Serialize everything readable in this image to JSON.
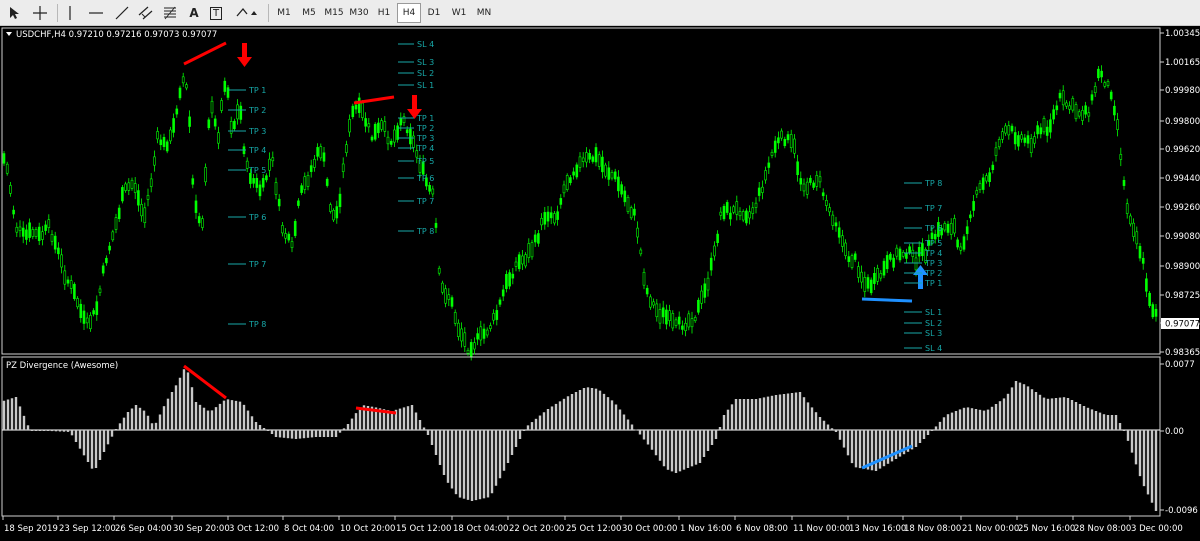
{
  "toolbar": {
    "drawing_tools": [
      "cursor-icon",
      "crosshair-icon",
      "vertical-line-icon",
      "horizontal-line-icon",
      "trendline-icon",
      "equidistant-channel-icon",
      "fibonacci-icon",
      "text-icon",
      "text-label-icon",
      "arrows-icon"
    ],
    "text_tool_label": "A",
    "text_label_tool_label": "T",
    "timeframes": [
      "M1",
      "M5",
      "M15",
      "M30",
      "H1",
      "H4",
      "D1",
      "W1",
      "MN"
    ],
    "selected_timeframe": "H4"
  },
  "chart": {
    "symbol_header": "USDCHF,H4  0.97210 0.97216 0.97073 0.97077",
    "price_ticks": [
      "1.00345",
      "1.00165",
      "0.99980",
      "0.99800",
      "0.99620",
      "0.99440",
      "0.99260",
      "0.99080",
      "0.98900",
      "0.98725",
      "0.98545",
      "0.98365"
    ],
    "last_price_marker": "0.97077",
    "level_labels": {
      "group1": [
        "TP 1",
        "TP 2",
        "TP 3",
        "TP 4",
        "TP 5",
        "TP 6",
        "TP 7",
        "TP 8"
      ],
      "group2_sl": [
        "SL 4",
        "SL 3",
        "SL 2",
        "SL 1"
      ],
      "group2_tp": [
        "TP 1",
        "TP 2",
        "TP 3",
        "TP 4",
        "TP 5",
        "TP 6",
        "TP 7",
        "TP 8"
      ],
      "group3_tp": [
        "TP 8",
        "TP 7",
        "TP 6",
        "TP 5",
        "TP 4",
        "TP 3",
        "TP 2",
        "TP 1"
      ],
      "group3_sl": [
        "SL 1",
        "SL 2",
        "SL 3",
        "SL 4"
      ]
    },
    "colors": {
      "background": "#000000",
      "candles": "#00ff00",
      "bearish_marker": "#ff0000",
      "bullish_marker": "#1e90ff",
      "histogram": "#c8c8c8",
      "level_lines": "#17a7a7",
      "axis_text": "#ffffff"
    }
  },
  "indicator": {
    "title": "PZ Divergence (Awesome)",
    "ticks": [
      "0.0077",
      "0.00",
      "-0.0096"
    ]
  },
  "time_axis": [
    "18 Sep 2019",
    "23 Sep 12:00",
    "26 Sep 04:00",
    "30 Sep 20:00",
    "3 Oct 12:00",
    "8 Oct 04:00",
    "10 Oct 20:00",
    "15 Oct 12:00",
    "18 Oct 04:00",
    "22 Oct 20:00",
    "25 Oct 12:00",
    "30 Oct 00:00",
    "1 Nov 16:00",
    "6 Nov 08:00",
    "11 Nov 00:00",
    "13 Nov 16:00",
    "18 Nov 08:00",
    "21 Nov 00:00",
    "25 Nov 16:00",
    "28 Nov 08:00",
    "3 Dec 00:00"
  ]
}
